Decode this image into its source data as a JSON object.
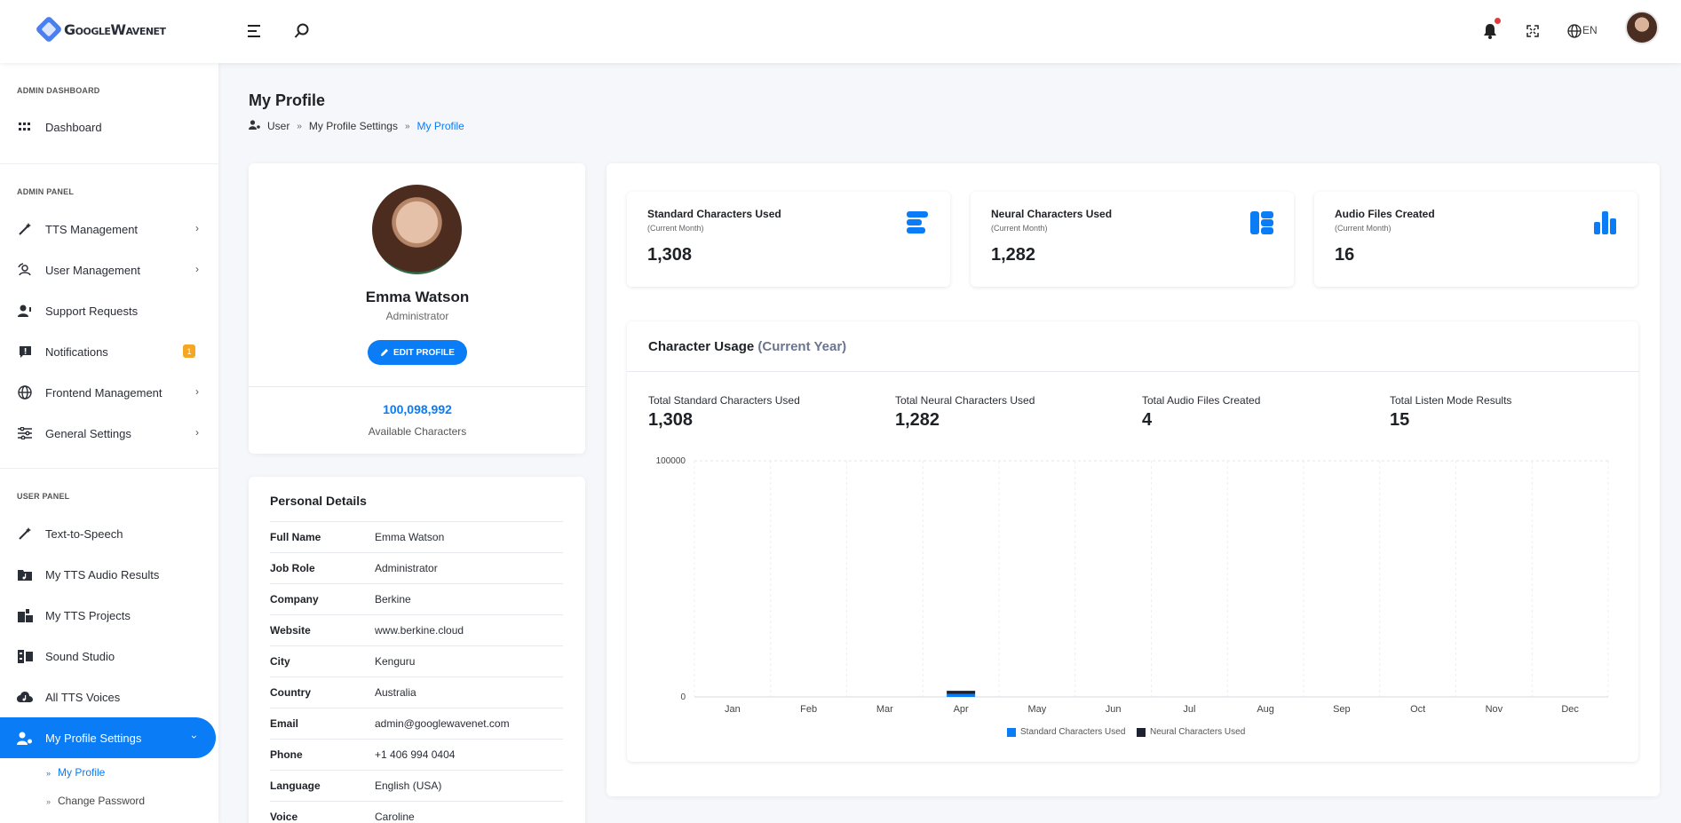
{
  "topbar": {
    "brand": "GoogleWavenet",
    "lang": "EN",
    "icons": [
      "menu-icon",
      "search-icon",
      "bell-icon",
      "fullscreen-icon",
      "globe-icon"
    ]
  },
  "sidebar": {
    "section_admin_dashboard": "ADMIN DASHBOARD",
    "dashboard": "Dashboard",
    "section_admin_panel": "ADMIN PANEL",
    "tts_management": "TTS Management",
    "user_management": "User Management",
    "support_requests": "Support Requests",
    "notifications": "Notifications",
    "notifications_count": "1",
    "frontend_management": "Frontend Management",
    "general_settings": "General Settings",
    "section_user_panel": "USER PANEL",
    "text_to_speech": "Text-to-Speech",
    "my_tts_audio_results": "My TTS Audio Results",
    "my_tts_projects": "My TTS Projects",
    "sound_studio": "Sound Studio",
    "all_tts_voices": "All TTS Voices",
    "my_profile_settings": "My Profile Settings",
    "my_profile": "My Profile",
    "change_password": "Change Password"
  },
  "page": {
    "title": "My Profile",
    "breadcrumb": [
      "User",
      "My Profile Settings",
      "My Profile"
    ]
  },
  "profile": {
    "name": "Emma Watson",
    "role": "Administrator",
    "edit_label": "EDIT PROFILE",
    "available_characters": "100,098,992",
    "available_label": "Available Characters"
  },
  "personal_details": {
    "title": "Personal Details",
    "rows": [
      {
        "key": "Full Name",
        "value": "Emma Watson"
      },
      {
        "key": "Job Role",
        "value": "Administrator"
      },
      {
        "key": "Company",
        "value": "Berkine"
      },
      {
        "key": "Website",
        "value": "www.berkine.cloud"
      },
      {
        "key": "City",
        "value": "Kenguru"
      },
      {
        "key": "Country",
        "value": "Australia"
      },
      {
        "key": "Email",
        "value": "admin@googlewavenet.com"
      },
      {
        "key": "Phone",
        "value": "+1 406 994 0404"
      },
      {
        "key": "Language",
        "value": "English (USA)"
      },
      {
        "key": "Voice",
        "value": "Caroline"
      }
    ]
  },
  "stats": [
    {
      "title": "Standard Characters Used",
      "sub": "(Current Month)",
      "value": "1,308"
    },
    {
      "title": "Neural Characters Used",
      "sub": "(Current Month)",
      "value": "1,282"
    },
    {
      "title": "Audio Files Created",
      "sub": "(Current Month)",
      "value": "16"
    }
  ],
  "usage": {
    "title": "Character Usage",
    "title_suffix": "(Current Year)",
    "totals": [
      {
        "label": "Total Standard Characters Used",
        "value": "1,308"
      },
      {
        "label": "Total Neural Characters Used",
        "value": "1,282"
      },
      {
        "label": "Total Audio Files Created",
        "value": "4"
      },
      {
        "label": "Total Listen Mode Results",
        "value": "15"
      }
    ]
  },
  "colors": {
    "accent": "#0a7cf5",
    "neural": "#1e2230",
    "badge": "#f5a623"
  },
  "chart_data": {
    "type": "bar",
    "categories": [
      "Jan",
      "Feb",
      "Mar",
      "Apr",
      "May",
      "Jun",
      "Jul",
      "Aug",
      "Sep",
      "Oct",
      "Nov",
      "Dec"
    ],
    "series": [
      {
        "name": "Standard Characters Used",
        "color": "#0a7cf5",
        "values": [
          0,
          0,
          0,
          1308,
          0,
          0,
          0,
          0,
          0,
          0,
          0,
          0
        ]
      },
      {
        "name": "Neural Characters Used",
        "color": "#1e2230",
        "values": [
          0,
          0,
          0,
          1282,
          0,
          0,
          0,
          0,
          0,
          0,
          0,
          0
        ]
      }
    ],
    "stacked": true,
    "ylim": [
      0,
      100000
    ],
    "yticks": [
      "0",
      "100000"
    ],
    "grid": true,
    "legend": "bottom"
  }
}
